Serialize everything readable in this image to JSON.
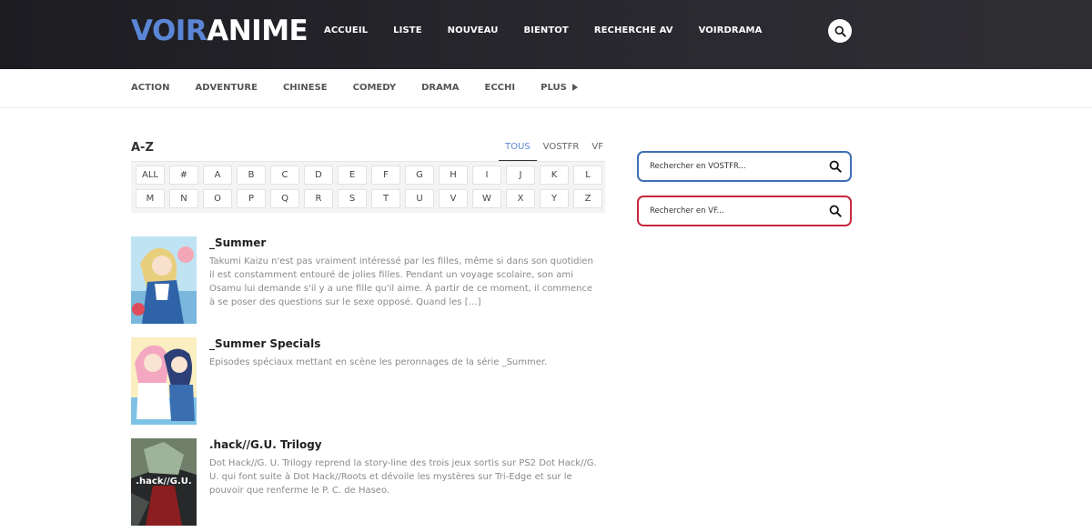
{
  "brand": {
    "part1": "VOIR",
    "part2": "ANIME",
    "accent": "#5b86d6"
  },
  "topnav": [
    "ACCUEIL",
    "LISTE",
    "NOUVEAU",
    "BIENTOT",
    "RECHERCHE AV",
    "VOIRDRAMA"
  ],
  "genres": [
    "ACTION",
    "ADVENTURE",
    "CHINESE",
    "COMEDY",
    "DRAMA",
    "ECCHI"
  ],
  "genres_more": "PLUS",
  "az": {
    "title": "A-Z",
    "tabs": [
      "TOUS",
      "VOSTFR",
      "VF"
    ],
    "active_tab": "TOUS",
    "letters": [
      "ALL",
      "#",
      "A",
      "B",
      "C",
      "D",
      "E",
      "F",
      "G",
      "H",
      "I",
      "J",
      "K",
      "L",
      "M",
      "N",
      "O",
      "P",
      "Q",
      "R",
      "S",
      "T",
      "U",
      "V",
      "W",
      "X",
      "Y",
      "Z"
    ]
  },
  "anime": [
    {
      "title": "_Summer",
      "description": "Takumi Kaizu n'est pas vraiment intéressé par les filles, même si dans son quotidien il est constamment entouré de jolies filles. Pendant un voyage scolaire, son ami Osamu lui demande s'il y a une fille qu'il aime. À partir de ce moment, il commence à se poser des questions sur le sexe opposé. Quand les […]"
    },
    {
      "title": "_Summer Specials",
      "description": "Episodes spéciaux mettant en scène les peronnages de la série _Summer."
    },
    {
      "title": ".hack//G.U. Trilogy",
      "description": "Dot Hack//G. U. Trilogy reprend la story-line des trois jeux sortis sur PS2 Dot Hack//G. U. qui font suite à Dot Hack//Roots et dévoile les mystères sur Tri-Edge et sur le pouvoir que renferme le P. C. de Haseo.",
      "cover_text": ".hack//G.U."
    }
  ],
  "sidebar": {
    "search_vostfr": {
      "placeholder": "Rechercher en VOSTFR...",
      "border_color": "#3f6fb5"
    },
    "search_vf": {
      "placeholder": "Rechercher en VF...",
      "border_color": "#c8283c"
    }
  }
}
